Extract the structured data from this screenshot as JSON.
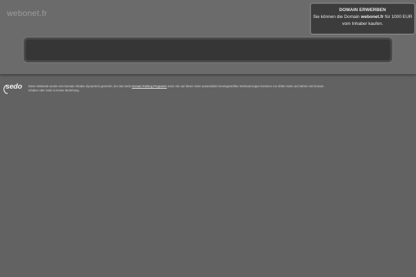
{
  "header": {
    "site_title": "webonet.fr"
  },
  "buy_box": {
    "title": "DOMAIN ERWERBEN",
    "text_before": "Sie können die Domain ",
    "domain": "webonet.fr",
    "text_after": " für 1000 EUR vom Inhaber kaufen."
  },
  "search": {
    "value": ""
  },
  "footer": {
    "logo_text": "sedo",
    "disclaimer_part1": "Diese Webseite wurde vom Domain Inhaber dynamisch generiert, der das Sedo ",
    "disclaimer_link": "Domain Parking Programm",
    "disclaimer_part2": " nutzt. Die auf dieser Seite automatisiert bereitgestellten Werbeanzeigen kommen von dritter Seite und stehen mit Domain Inhaber oder Sedo in keiner Beziehung."
  },
  "colors": {
    "background": "#626262",
    "header_background": "#6b6b6b",
    "buy_box_background": "#3c3c3c",
    "search_background": "#363636"
  }
}
